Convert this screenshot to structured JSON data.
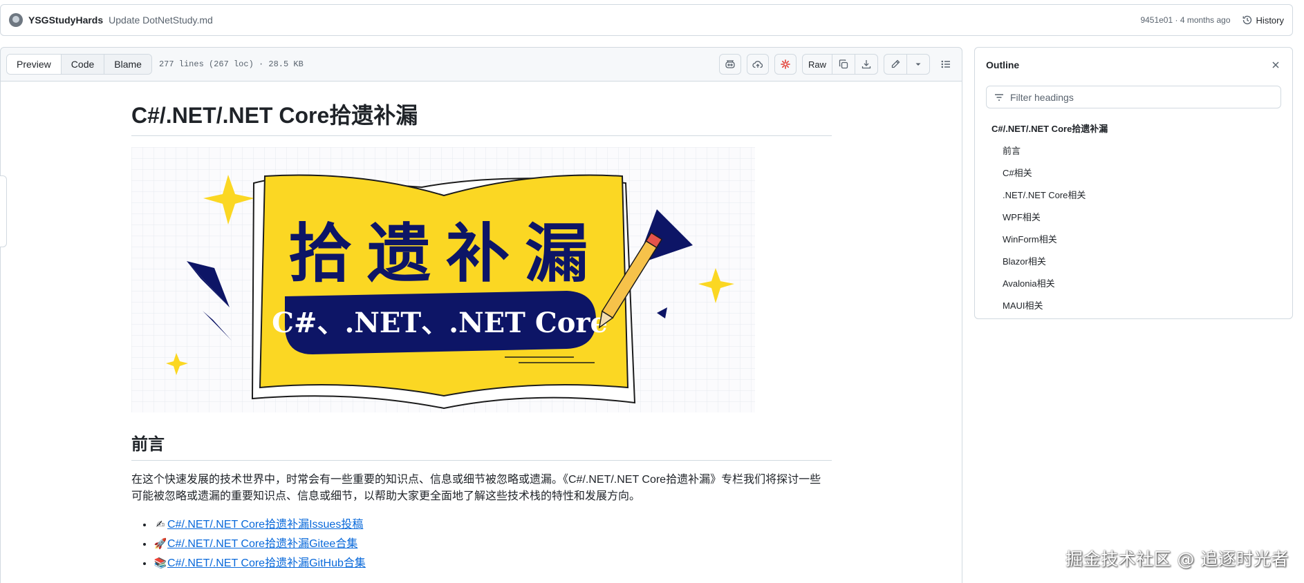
{
  "commit": {
    "author": "YSGStudyHards",
    "message": "Update DotNetStudy.md",
    "sha_time": "9451e01 · 4 months ago",
    "history_label": "History"
  },
  "file_header": {
    "tabs": [
      {
        "label": "Preview",
        "active": true
      },
      {
        "label": "Code",
        "active": false
      },
      {
        "label": "Blame",
        "active": false
      }
    ],
    "info": "277 lines (267 loc) · 28.5 KB",
    "raw_label": "Raw"
  },
  "markdown": {
    "title": "C#/.NET/.NET Core拾遗补漏",
    "banner": {
      "headline": "拾遗补漏",
      "subtitle": "C#、.NET、.NET Core"
    },
    "section_title": "前言",
    "paragraph": "在这个快速发展的技术世界中，时常会有一些重要的知识点、信息或细节被忽略或遗漏。《C#/.NET/.NET Core拾遗补漏》专栏我们将探讨一些可能被忽略或遗漏的重要知识点、信息或细节，以帮助大家更全面地了解这些技术栈的特性和发展方向。",
    "links": [
      {
        "emoji": "✍",
        "text": "C#/.NET/.NET Core拾遗补漏Issues投稿"
      },
      {
        "emoji": "🚀",
        "text": "C#/.NET/.NET Core拾遗补漏Gitee合集"
      },
      {
        "emoji": "📚",
        "text": "C#/.NET/.NET Core拾遗补漏GitHub合集"
      }
    ]
  },
  "outline": {
    "title": "Outline",
    "filter_placeholder": "Filter headings",
    "items": [
      {
        "label": "C#/.NET/.NET Core拾遗补漏",
        "level": 1
      },
      {
        "label": "前言",
        "level": 2
      },
      {
        "label": "C#相关",
        "level": 2
      },
      {
        "label": ".NET/.NET Core相关",
        "level": 2
      },
      {
        "label": "WPF相关",
        "level": 2
      },
      {
        "label": "WinForm相关",
        "level": 2
      },
      {
        "label": "Blazor相关",
        "level": 2
      },
      {
        "label": "Avalonia相关",
        "level": 2
      },
      {
        "label": "MAUI相关",
        "level": 2
      }
    ]
  },
  "watermark": "掘金技术社区 @ 追逐时光者",
  "colors": {
    "link": "#0969da",
    "banner_yellow": "#fbd723",
    "banner_navy": "#0d1566"
  }
}
